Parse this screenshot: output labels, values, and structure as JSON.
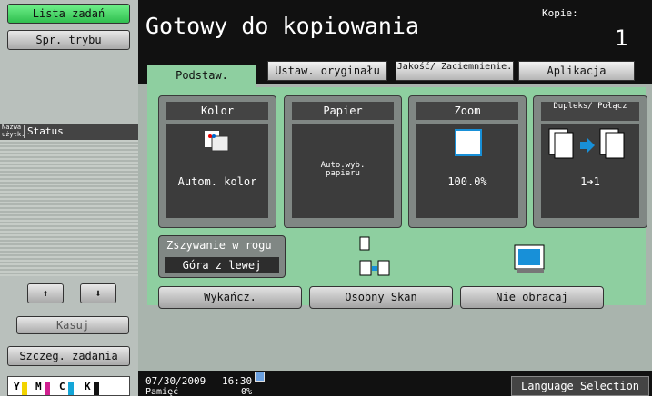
{
  "left_panel": {
    "task_list_label": "Lista zadań",
    "mode_check_label": "Spr. trybu",
    "col_user": "Nazwa użytk.",
    "col_status": "Status",
    "cancel_label": "Kasuj",
    "job_details_label": "Szczeg. zadania",
    "toner": [
      "Y",
      "M",
      "C",
      "K"
    ]
  },
  "header": {
    "title": "Gotowy do kopiowania",
    "copies_label": "Kopie:",
    "copies_value": "1"
  },
  "tabs": [
    {
      "label": "Podstaw."
    },
    {
      "label": "Ustaw. oryginału"
    },
    {
      "label": "Jakość/ Zaciemnienie."
    },
    {
      "label": "Aplikacja"
    }
  ],
  "cards": {
    "color": {
      "title": "Kolor",
      "value": "Autom. kolor"
    },
    "paper": {
      "title": "Papier",
      "value": "Auto.wyb. papieru"
    },
    "zoom": {
      "title": "Zoom",
      "value": "100.0%"
    },
    "duplex": {
      "title": "Dupleks/ Połącz",
      "value": "1➔1"
    }
  },
  "staple": {
    "label": "Zszywanie w rogu",
    "value": "Góra z lewej"
  },
  "buttons": {
    "finish": "Wykańcz.",
    "separate_scan": "Osobny Skan",
    "no_rotate": "Nie obracaj",
    "language": "Language Selection"
  },
  "status": {
    "date": "07/30/2009",
    "time": "16:30",
    "memory_label": "Pamięć",
    "memory_value": "0%"
  },
  "colors": {
    "accent_green": "#4fd86a",
    "header_bg": "#111111"
  }
}
